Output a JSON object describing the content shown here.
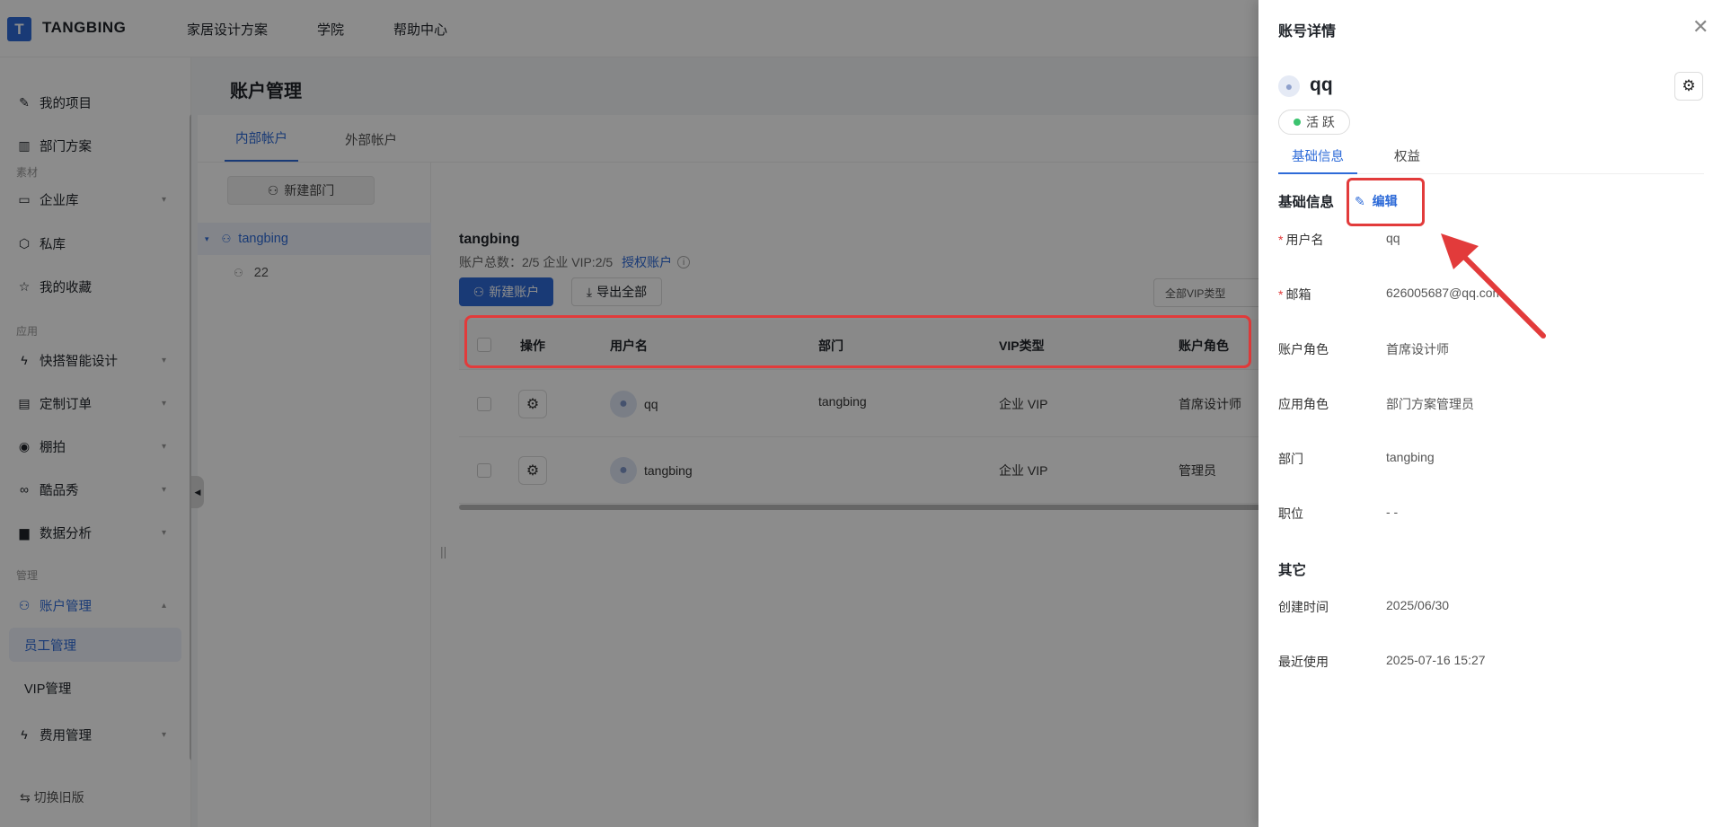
{
  "topbar": {
    "logo_letter": "T",
    "brand": "TANGBING",
    "nav": [
      "家居设计方案",
      "学院",
      "帮助中心"
    ]
  },
  "sidebar": {
    "items": [
      {
        "label": "我的项目",
        "icon": "edit-icon"
      },
      {
        "label": "部门方案",
        "icon": "building-icon"
      },
      {
        "label": "企业库",
        "icon": "folder-icon"
      },
      {
        "label": "私库",
        "icon": "cube-icon"
      },
      {
        "label": "我的收藏",
        "icon": "star-icon"
      },
      {
        "label": "快搭智能设计",
        "icon": "lightning-icon"
      },
      {
        "label": "定制订单",
        "icon": "clipboard-icon"
      },
      {
        "label": "棚拍",
        "icon": "camera-icon"
      },
      {
        "label": "酷品秀",
        "icon": "link-icon"
      },
      {
        "label": "数据分析",
        "icon": "bar-chart-icon"
      },
      {
        "label": "账户管理",
        "icon": "users-icon"
      },
      {
        "label": "费用管理",
        "icon": "lightning-icon"
      }
    ],
    "groups": [
      "素材",
      "应用",
      "管理"
    ],
    "subitems": [
      "员工管理",
      "VIP管理"
    ],
    "footer": "切换旧版"
  },
  "main": {
    "title": "账户管理",
    "tabs": [
      "内部帐户",
      "外部帐户"
    ],
    "new_dept": "新建部门",
    "dept_root": "tangbing",
    "dept_child": "22",
    "org_name": "tangbing",
    "stats": "账户总数：2/5   企业 VIP:2/5",
    "auth_link": "授权账户",
    "new_account": "新建账户",
    "export_all": "导出全部",
    "vip_filter": "全部VIP类型",
    "columns": [
      "操作",
      "用户名",
      "部门",
      "VIP类型",
      "账户角色"
    ],
    "rows": [
      {
        "username": "qq",
        "dept": "tangbing",
        "vip": "企业 VIP",
        "role": "首席设计师"
      },
      {
        "username": "tangbing",
        "dept": "",
        "vip": "企业 VIP",
        "role": "管理员"
      }
    ]
  },
  "drawer": {
    "title": "账号详情",
    "username": "qq",
    "status": "活 跃",
    "tabs": [
      "基础信息",
      "权益"
    ],
    "section_basic": "基础信息",
    "edit": "编辑",
    "fields": [
      {
        "label": "用户名",
        "value": "qq",
        "required": true
      },
      {
        "label": "邮箱",
        "value": "626005687@qq.com",
        "required": true
      },
      {
        "label": "账户角色",
        "value": "首席设计师"
      },
      {
        "label": "应用角色",
        "value": "部门方案管理员"
      },
      {
        "label": "部门",
        "value": "tangbing"
      },
      {
        "label": "职位",
        "value": "- -"
      }
    ],
    "section_other": "其它",
    "other_fields": [
      {
        "label": "创建时间",
        "value": "2025/06/30"
      },
      {
        "label": "最近使用",
        "value": "2025-07-16 15:27"
      }
    ]
  },
  "colors": {
    "primary": "#2e6bd8",
    "highlight": "#e23b3b",
    "active_dot": "#3cc36f"
  }
}
